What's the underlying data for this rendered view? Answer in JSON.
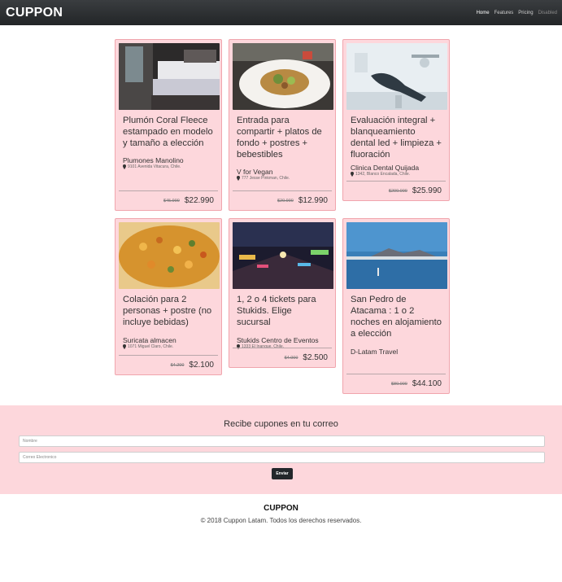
{
  "navbar": {
    "brand": "CUPPON",
    "links": [
      {
        "label": "Home"
      },
      {
        "label": "Features"
      },
      {
        "label": "Pricing"
      },
      {
        "label": "Disabled"
      }
    ]
  },
  "deals": [
    {
      "title": "Plumón Coral Fleece estampado en modelo y tamaño a elección",
      "vendor": "Plumones Manolino",
      "address": "9101 Avenida Vitacura, Chile.",
      "old_price": "$45.990",
      "price": "$22.990"
    },
    {
      "title": "Entrada para compartir + platos de fondo + postres + bebestibles",
      "vendor": "V for Vegan",
      "address": "777 Jesse Pinkman, Chile.",
      "old_price": "$20.990",
      "price": "$12.990"
    },
    {
      "title": "Evaluación integral + blanqueamiento dental led + limpieza + fluoración",
      "vendor": "Clinica Dental Quijada",
      "address": "1342, Blanco Encalada, Chile.",
      "old_price": "$200.000",
      "price": "$25.990"
    },
    {
      "title": "Colación para 2 personas + postre (no incluye bebidas)",
      "vendor": "Suricata almacen",
      "address": "1071 Miguel Claro, Chile.",
      "old_price": "$4.200",
      "price": "$2.100"
    },
    {
      "title": "1, 2 o 4 tickets para Stukids. Elige sucursal",
      "vendor": "Stukids Centro de Eventos",
      "address": "1333 El Inanque, Chile.",
      "old_price": "$4.000",
      "price": "$2.500"
    },
    {
      "title": "San Pedro de Atacama : 1 o 2 noches en alojamiento a elección",
      "vendor": "D-Latam Travel",
      "address": "",
      "old_price": "$80.000",
      "price": "$44.100"
    }
  ],
  "subscribe": {
    "title": "Recibe cupones en tu correo",
    "name_placeholder": "Nombre",
    "email_placeholder": "Correo Electronico",
    "button": "Enviar"
  },
  "footer": {
    "brand": "CUPPON",
    "copyright": "© 2018 Cuppon Latam. Todos los derechos reservados."
  }
}
